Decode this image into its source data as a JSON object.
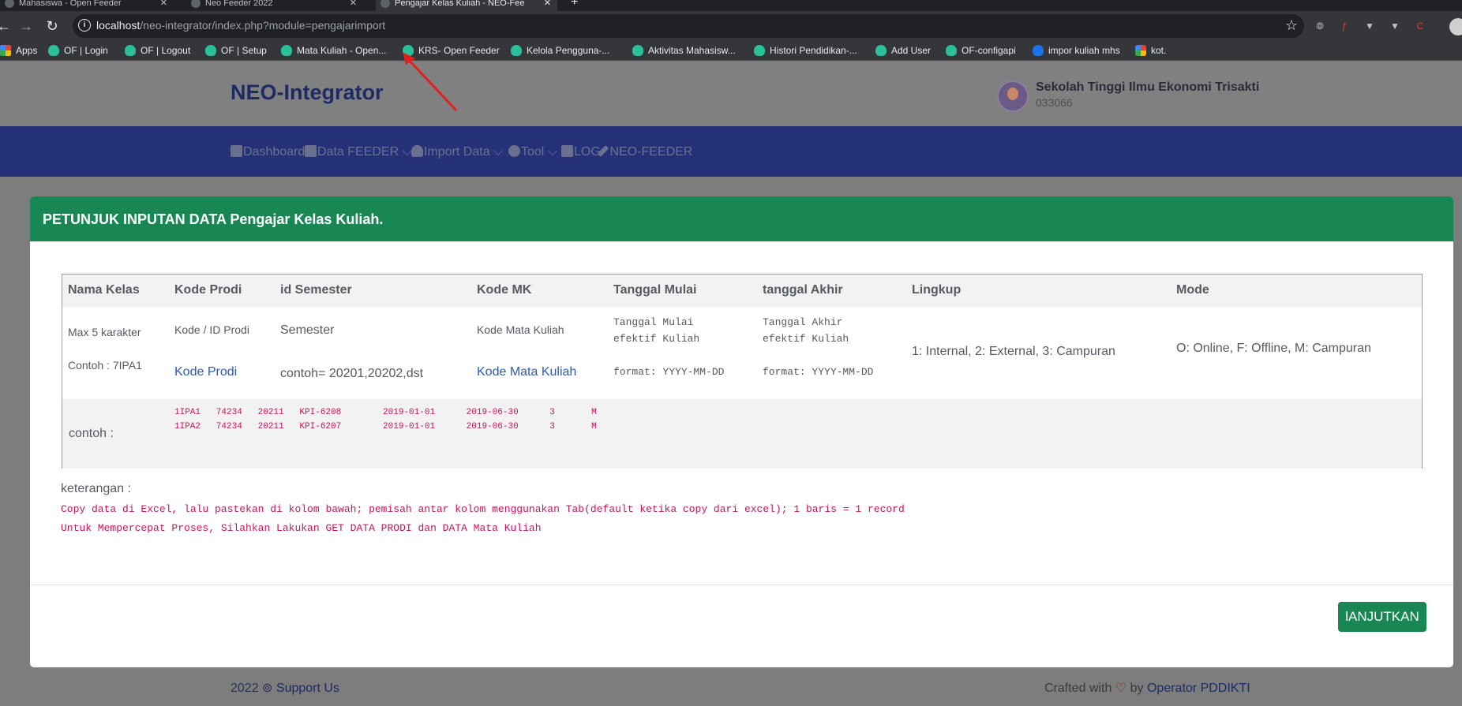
{
  "browser": {
    "tabs": [
      {
        "title": "Mahasiswa - Open Feeder",
        "active": false
      },
      {
        "title": "Neo Feeder 2022",
        "active": false
      },
      {
        "title": "Pengajar Kelas Kuliah - NEO-Fee",
        "active": true
      }
    ],
    "url_host": "localhost",
    "url_path": "/neo-integrator/index.php?module=pengajarimport",
    "bookmarks": [
      {
        "label": "Apps",
        "icon": "apps-grid-icon"
      },
      {
        "label": "OF | Login",
        "icon": "feeder-icon"
      },
      {
        "label": "OF | Logout",
        "icon": "feeder-icon"
      },
      {
        "label": "OF | Setup",
        "icon": "feeder-icon"
      },
      {
        "label": "Mata Kuliah - Open...",
        "icon": "feeder-icon"
      },
      {
        "label": "KRS- Open Feeder",
        "icon": "feeder-icon"
      },
      {
        "label": "Kelola Pengguna-...",
        "icon": "feeder-icon"
      },
      {
        "label": "Aktivitas Mahasisw...",
        "icon": "feeder-icon"
      },
      {
        "label": "Histori Pendidikan-...",
        "icon": "feeder-icon"
      },
      {
        "label": "Add User",
        "icon": "feeder-icon"
      },
      {
        "label": "OF-configapi",
        "icon": "feeder-icon"
      },
      {
        "label": "impor kuliah mhs",
        "icon": "blue-icon"
      },
      {
        "label": "kot.",
        "icon": "multicolor-icon"
      }
    ]
  },
  "header": {
    "brand": "NEO-Integrator",
    "institution_name": "Sekolah Tinggi Ilmu Ekonomi Trisakti",
    "institution_code": "033066"
  },
  "menu": {
    "dashboard": "Dashboard",
    "data_feeder": "Data FEEDER",
    "import_data": "Import Data",
    "tool": "Tool",
    "log": "LOG",
    "neo_feeder": "NEO-FEEDER"
  },
  "modal": {
    "title": "PETUNJUK INPUTAN DATA Pengajar Kelas Kuliah.",
    "columns": [
      "Nama Kelas",
      "Kode Prodi",
      "id Semester",
      "Kode MK",
      "Tanggal Mulai",
      "tanggal Akhir",
      "Lingkup",
      "Mode"
    ],
    "desc": {
      "nama_kelas_1": "Max 5 karakter",
      "nama_kelas_2": "Contoh : 7IPA1",
      "kode_prodi_1": "Kode / ID Prodi",
      "kode_prodi_link": "Kode Prodi",
      "semester_1": "Semester",
      "semester_2": "contoh= 20201,20202,dst",
      "kode_mk_1": "Kode Mata Kuliah",
      "kode_mk_link": "Kode Mata Kuliah",
      "tgl_mulai_1": "Tanggal Mulai",
      "tgl_mulai_2": "efektif Kuliah",
      "tgl_mulai_3": "format: YYYY-MM-DD",
      "tgl_akhir_1": "Tanggal Akhir",
      "tgl_akhir_2": "efektif Kuliah",
      "tgl_akhir_3": "format: YYYY-MM-DD",
      "lingkup": "1: Internal, 2: External, 3: Campuran",
      "mode": "O: Online, F: Offline, M: Campuran"
    },
    "example_label": "contoh :",
    "example_lines": [
      "1IPA1   74234   20211   KPI-6208        2019-01-01      2019-06-30      3       M",
      "1IPA2   74234   20211   KPI-6207        2019-01-01      2019-06-30      3       M"
    ],
    "keterangan_label": "keterangan :",
    "keterangan_lines": [
      "Copy data di Excel, lalu pastekan di kolom bawah; pemisah antar kolom menggunakan Tab(default ketika copy dari excel); 1 baris = 1 record",
      "Untuk Mempercepat Proses, Silahkan Lakukan GET DATA PRODI dan DATA Mata Kuliah"
    ],
    "next_button": "lANJUTKAN"
  },
  "footer": {
    "year": "2022",
    "support": "Support Us",
    "crafted": "Crafted with",
    "by": "by",
    "operator": "Operator PDDIKTI"
  },
  "colors": {
    "modal_header": "#198754",
    "menubar": "#263277",
    "code_text": "#c2185b",
    "link": "#2a5db0"
  }
}
